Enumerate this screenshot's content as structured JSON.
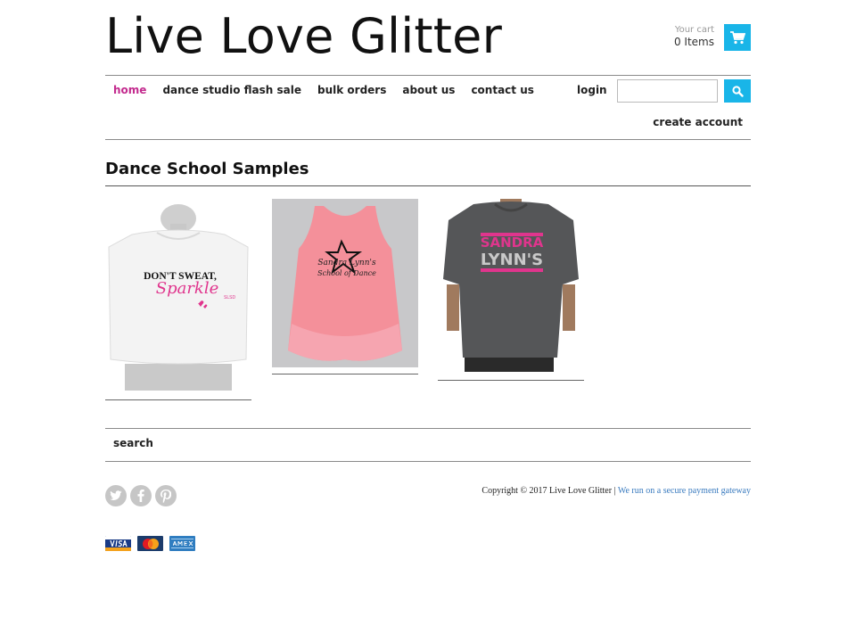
{
  "header": {
    "brand": "Live Love Glitter",
    "cart_label": "Your cart",
    "cart_count": "0 Items"
  },
  "nav": {
    "items": [
      {
        "label": "home",
        "active": true
      },
      {
        "label": "dance studio flash sale",
        "active": false
      },
      {
        "label": "bulk orders",
        "active": false
      },
      {
        "label": "about us",
        "active": false
      },
      {
        "label": "contact us",
        "active": false
      }
    ],
    "login": "login",
    "create_account": "create account",
    "search_value": "",
    "search_placeholder": ""
  },
  "collection": {
    "title": "Dance School Samples",
    "products": [
      {
        "image": "white crop top \"Don't Sweat, Sparkle\""
      },
      {
        "image": "pink tank \"Sandra Lynn's School of Dance\""
      },
      {
        "image": "gray tee \"Sandra Lynn's\""
      }
    ]
  },
  "footer": {
    "search_link": "search",
    "copyright": "Copyright © 2017 Live Love Glitter | ",
    "gateway": "We run on a secure payment gateway",
    "social_icons": [
      "twitter-icon",
      "facebook-icon",
      "pinterest-icon"
    ],
    "payment_icons": [
      "visa-icon",
      "mastercard-icon",
      "amex-icon"
    ]
  },
  "colors": {
    "accent": "#19b5e8",
    "active_nav": "#c32b8e",
    "social_gray": "#c6c6c6",
    "link_blue": "#3a7bbf"
  }
}
